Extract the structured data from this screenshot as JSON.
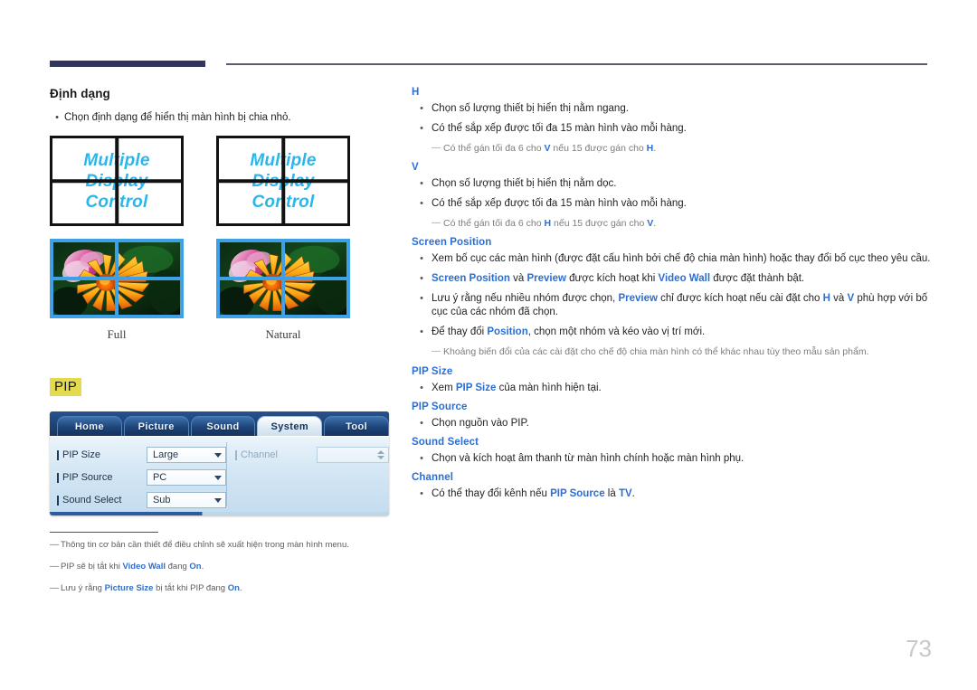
{
  "header": {
    "rule": "decorative-rule"
  },
  "page_number": "73",
  "left": {
    "format_heading": "Định dạng",
    "format_bullet": "Chọn định dạng để hiển thị màn hình bị chia nhỏ.",
    "monitor_label": "Multiple\nDisplay\nControl",
    "captions": [
      "Full",
      "Natural"
    ],
    "pip_heading": "PIP",
    "footnotes": [
      {
        "prefix": "Thông tin cơ bản cần thiết để điều chỉnh sẽ xuất hiện trong màn hình menu.",
        "parts": []
      },
      {
        "text_a": "PIP sẽ bị tắt khi ",
        "em_a": "Video Wall",
        "text_b": " đang ",
        "em_b": "On",
        "text_c": "."
      },
      {
        "text_a": "Lưu ý rằng ",
        "em_a": "Picture Size",
        "text_b": " bị tắt khi PIP đang ",
        "em_b": "On",
        "text_c": "."
      }
    ]
  },
  "osd": {
    "tabs": [
      "Home",
      "Picture",
      "Sound",
      "System",
      "Tool"
    ],
    "active_tab": "System",
    "rows": [
      {
        "label": "PIP Size",
        "value": "Large"
      },
      {
        "label": "PIP Source",
        "value": "PC"
      },
      {
        "label": "Sound Select",
        "value": "Sub"
      }
    ],
    "right_row": {
      "label": "Channel",
      "value": ""
    }
  },
  "right": {
    "sections": [
      {
        "title": "H",
        "bullets": [
          "Chọn số lượng thiết bị hiển thị nằm ngang.",
          "Có thể sắp xếp được tối đa 15 màn hình vào mỗi hàng."
        ],
        "note": {
          "a": "Có thể gán tối đa 6 cho ",
          "e1": "V",
          "b": " nếu 15 được gán cho ",
          "e2": "H",
          "c": "."
        }
      },
      {
        "title": "V",
        "bullets": [
          "Chọn số lượng thiết bị hiển thị nằm dọc.",
          "Có thể sắp xếp được tối đa 15 màn hình vào mỗi hàng."
        ],
        "note": {
          "a": "Có thể gán tối đa 6 cho ",
          "e1": "H",
          "b": " nếu 15 được gán cho ",
          "e2": "V",
          "c": "."
        }
      }
    ],
    "screen_position": {
      "title": "Screen Position",
      "b1": "Xem bố cục các màn hình (được đặt cấu hình bởi chế độ chia màn hình) hoặc thay đổi bố cục theo yêu cầu.",
      "b2": {
        "e1": "Screen Position",
        "t1": " và ",
        "e2": "Preview",
        "t2": " được kích hoạt khi ",
        "e3": "Video Wall",
        "t3": " được đặt thành bật."
      },
      "b3": {
        "t1": "Lưu ý rằng nếu nhiều nhóm được chọn, ",
        "e1": "Preview",
        "t2": " chỉ được kích hoạt nếu cài đặt cho ",
        "e2": "H",
        "t3": " và ",
        "e3": "V",
        "t4": " phù hợp với bố cục của các nhóm đã chọn."
      },
      "b4": {
        "t1": "Để thay đổi ",
        "e1": "Position",
        "t2": ", chọn một nhóm và kéo vào vị trí mới."
      },
      "note": "Khoảng biến đổi của các cài đặt cho chế độ chia màn hình có thể khác nhau tùy theo mẫu sản phẩm."
    },
    "pip_sections": [
      {
        "title": "PIP Size",
        "b": {
          "t1": "Xem ",
          "e1": "PIP Size",
          "t2": " của màn hình hiện tại."
        }
      },
      {
        "title": "PIP Source",
        "b": {
          "t1": "Chọn nguồn vào PIP.",
          "e1": "",
          "t2": ""
        }
      },
      {
        "title": "Sound Select",
        "b": {
          "t1": "Chọn và kích hoạt âm thanh từ màn hình chính hoặc màn hình phụ.",
          "e1": "",
          "t2": ""
        }
      },
      {
        "title": "Channel",
        "b": {
          "t1": "Có thể thay đổi kênh nếu ",
          "e1": "PIP Source",
          "t2": " là ",
          "e2": "TV",
          "t3": "."
        }
      }
    ]
  },
  "colors": {
    "accent_blue": "#2b6fd4",
    "header_navy": "#32355e",
    "highlight_yellow": "#e4da4e",
    "mdc_cyan": "#29b6ec",
    "monitor_border_blue": "#3ea1e8"
  }
}
